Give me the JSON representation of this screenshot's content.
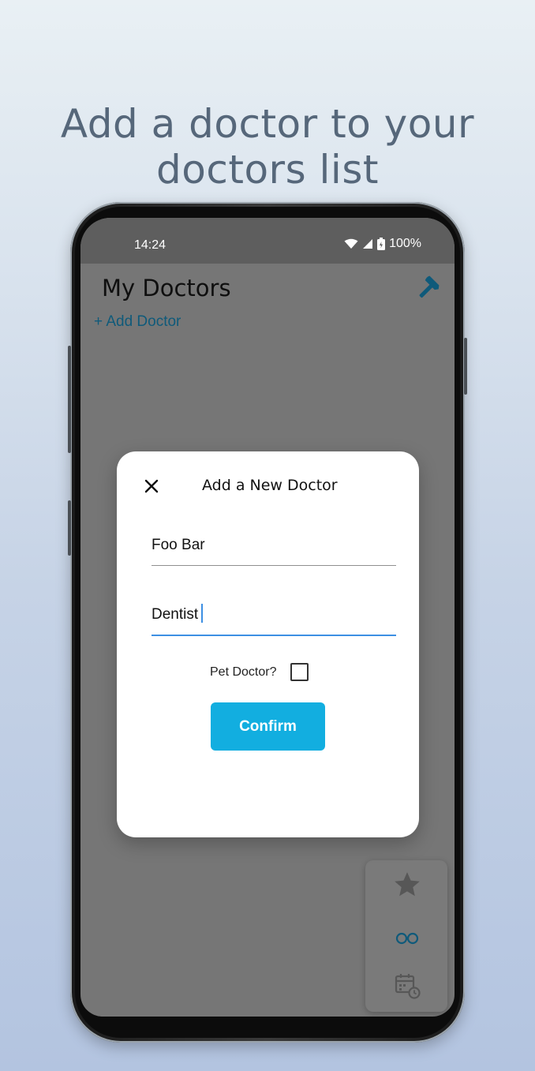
{
  "headline": {
    "line1": "Add a doctor to your",
    "line2": "doctors list"
  },
  "status_bar": {
    "time": "14:24",
    "battery": "100%"
  },
  "app": {
    "title": "My Doctors",
    "add_link": "+ Add Doctor",
    "accent_color": "#0f5a7a"
  },
  "dialog": {
    "title": "Add a New Doctor",
    "name_value": "Foo Bar",
    "specialty_value": "Dentist",
    "pet_label": "Pet Doctor?",
    "pet_checked": false,
    "confirm_label": "Confirm",
    "confirm_color": "#12aee0"
  },
  "side_panel": {
    "icons": [
      "star-icon",
      "glasses-icon",
      "calendar-clock-icon"
    ]
  }
}
